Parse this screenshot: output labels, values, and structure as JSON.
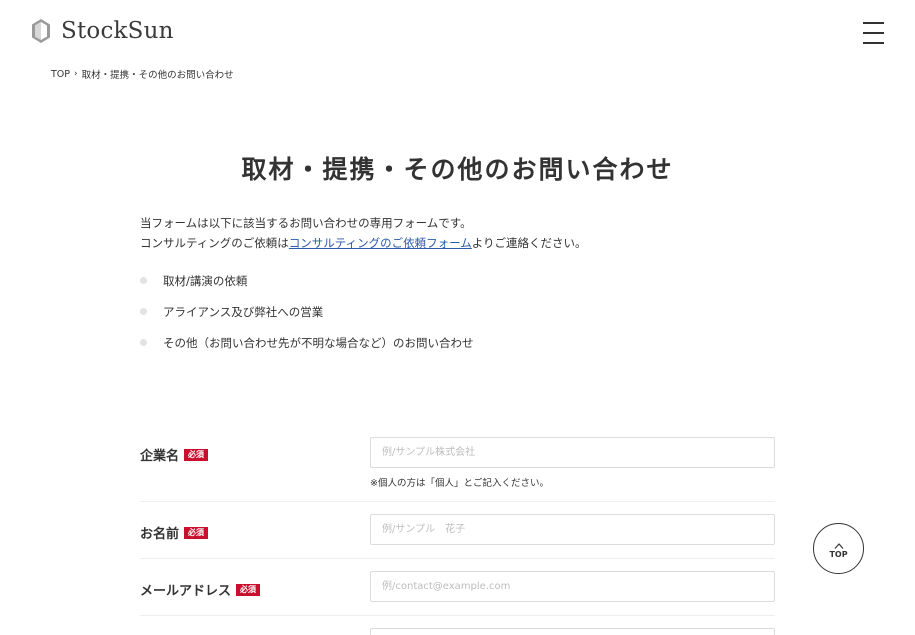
{
  "header": {
    "logo_text": "StockSun",
    "logo_icon": "hexagon-logo-icon",
    "menu_icon": "hamburger-menu-icon"
  },
  "breadcrumb": {
    "home": "TOP",
    "separator": "›",
    "current": "取材・提携・その他のお問い合わせ"
  },
  "page": {
    "title": "取材・提携・その他のお問い合わせ"
  },
  "intro": {
    "line1": "当フォームは以下に該当するお問い合わせの専用フォームです。",
    "line2_prefix": "コンサルティングのご依頼は",
    "line2_link": "コンサルティングのご依頼フォーム",
    "line2_suffix": "よりご連絡ください。"
  },
  "purposes": [
    "取材/講演の依頼",
    "アライアンス及び弊社への営業",
    "その他（お問い合わせ先が不明な場合など）のお問い合わせ"
  ],
  "form": {
    "required_label": "必須",
    "company": {
      "label": "企業名",
      "placeholder": "例/サンプル株式会社",
      "value": "",
      "note": "※個人の方は「個人」とご記入ください。"
    },
    "name": {
      "label": "お名前",
      "placeholder": "例/サンプル　花子",
      "value": ""
    },
    "email": {
      "label": "メールアドレス",
      "placeholder": "例/contact@example.com",
      "value": ""
    }
  },
  "scroll_top": {
    "label": "TOP",
    "icon": "chevron-up-icon"
  },
  "colors": {
    "text": "#333333",
    "link": "#2a5aa8",
    "required_badge": "#c8102e",
    "border": "#dcdcdc",
    "bullet": "#e3e3e3"
  }
}
